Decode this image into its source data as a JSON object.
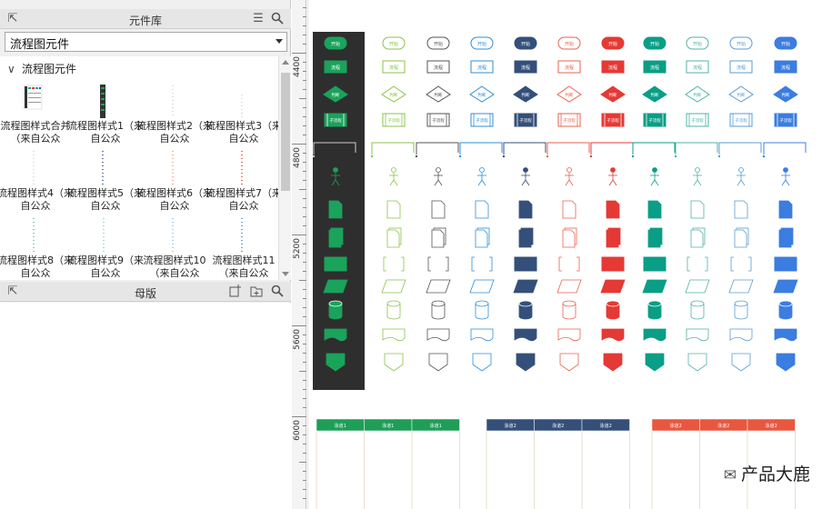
{
  "library_panel": {
    "title": "元件库",
    "selected_library": "流程图元件",
    "group_name": "流程图元件",
    "items": [
      {
        "label": "流程图样式合并（来自公众"
      },
      {
        "label": "流程图样式1（来自公众"
      },
      {
        "label": "流程图样式2（来自公众"
      },
      {
        "label": "流程图样式3（来自公众"
      },
      {
        "label": "流程图样式4（来自公众"
      },
      {
        "label": "流程图样式5（来自公众"
      },
      {
        "label": "流程图样式6（来自公众"
      },
      {
        "label": "流程图样式7（来自公众"
      },
      {
        "label": "流程图样式8（来自公众"
      },
      {
        "label": "流程图样式9（来自公众"
      },
      {
        "label": "流程图样式10（来自公众"
      },
      {
        "label": "流程图样式11（来自公众"
      }
    ]
  },
  "master_panel": {
    "title": "母版"
  },
  "ruler": {
    "labels": [
      "4400",
      "4800",
      "5200",
      "5600",
      "6000"
    ]
  },
  "canvas": {
    "column_colors": [
      "#ffffff",
      "#8bc34a",
      "#555555",
      "#2f8fd8",
      "#34507a",
      "#e9634d",
      "#e53935",
      "#0a9e86",
      "#4fb3a8",
      "#5b9bd5",
      "#3b7de0"
    ],
    "dark_column_bg": "#2e2e2e",
    "dark_column_accent": "#1aa35a",
    "shape_texts": [
      "开始",
      "流程",
      "判断",
      "子流程"
    ],
    "swimlanes": [
      {
        "color": "#1e9e57",
        "lanes": [
          "泳道1",
          "泳道1",
          "泳道1"
        ]
      },
      {
        "color": "#34507a",
        "lanes": [
          "泳道2",
          "泳道2",
          "泳道2"
        ]
      },
      {
        "color": "#e9573f",
        "lanes": [
          "泳道2",
          "泳道2",
          "泳道2"
        ]
      }
    ]
  },
  "watermark": {
    "text": "产品大鹿"
  }
}
